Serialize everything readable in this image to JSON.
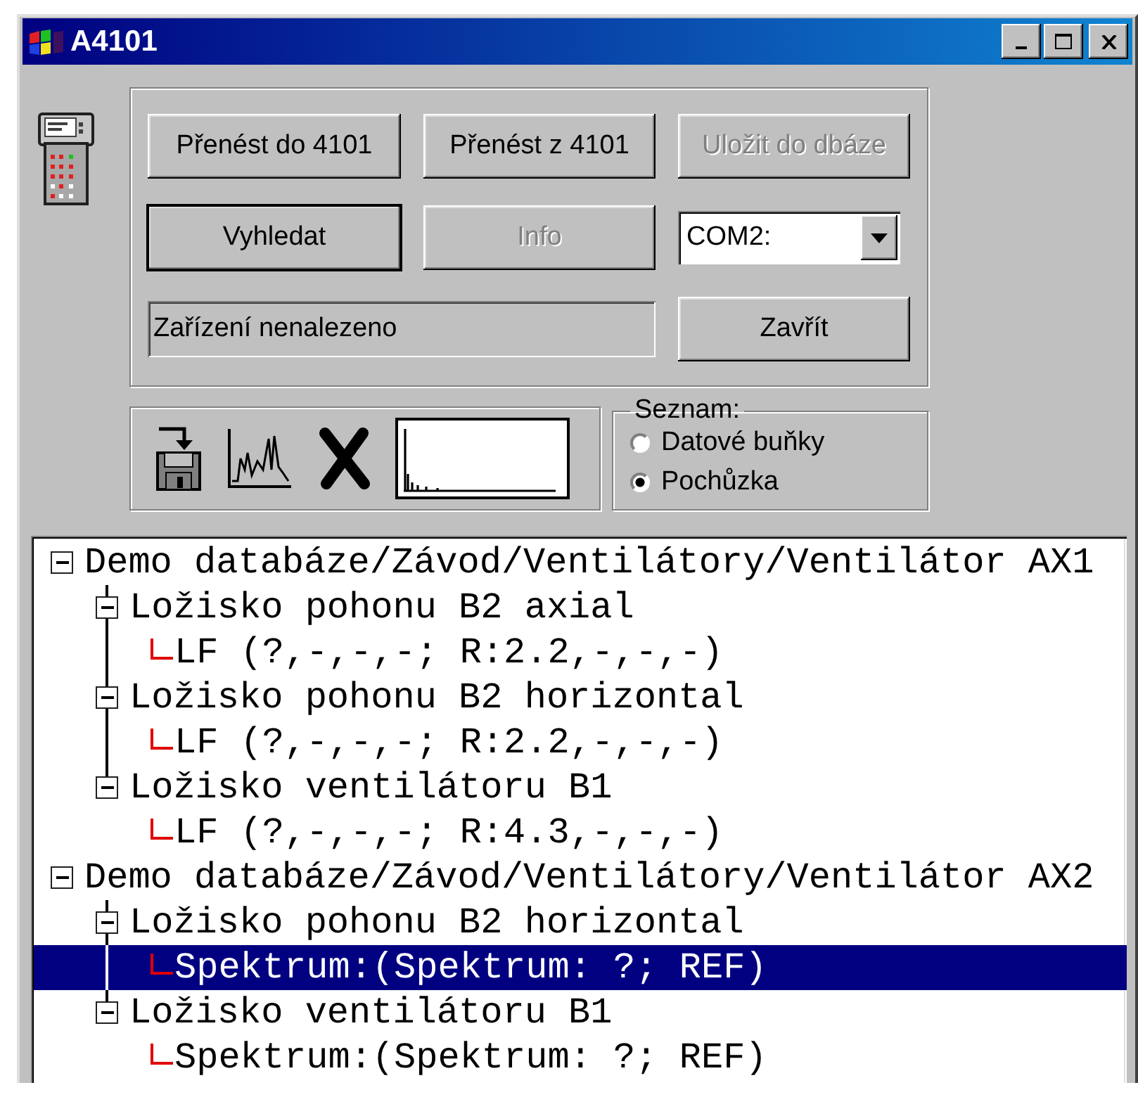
{
  "window": {
    "title": "A4101"
  },
  "actions": {
    "row_1": [
      {
        "label": "Přenést do 4101",
        "disabled": false,
        "default": false
      },
      {
        "label": "Přenést z 4101",
        "disabled": false,
        "default": false
      },
      {
        "label": "Uložit do dbáze",
        "disabled": true,
        "default": false
      }
    ],
    "row_2": [
      {
        "label": "Vyhledat",
        "disabled": false,
        "default": true
      },
      {
        "label": "Info",
        "disabled": true,
        "default": false
      }
    ],
    "port": {
      "value": "COM2:"
    },
    "status": "Zařízení nenalezeno",
    "close_button": "Zavřít"
  },
  "list_type": {
    "title": "Seznam:",
    "options": [
      {
        "label": "Datové buňky",
        "selected": false
      },
      {
        "label": "Pochůzka",
        "selected": true
      }
    ]
  },
  "tree": [
    {
      "label": "Demo databáze/Závod/Ventilátory/Ventilátor AX1",
      "expanded": true,
      "selected": false,
      "children": [
        {
          "label": "Ložisko pohonu B2 axial",
          "expanded": true,
          "selected": false,
          "children": [
            {
              "label": "LF (?,-,-,-; R:2.2,-,-,-)",
              "selected": false
            }
          ]
        },
        {
          "label": "Ložisko pohonu B2 horizontal",
          "expanded": true,
          "selected": false,
          "children": [
            {
              "label": "LF (?,-,-,-; R:2.2,-,-,-)",
              "selected": false
            }
          ]
        },
        {
          "label": "Ložisko ventilátoru B1",
          "expanded": true,
          "selected": false,
          "children": [
            {
              "label": "LF (?,-,-,-; R:4.3,-,-,-)",
              "selected": false
            }
          ]
        }
      ]
    },
    {
      "label": "Demo databáze/Závod/Ventilátory/Ventilátor AX2",
      "expanded": true,
      "selected": false,
      "children": [
        {
          "label": "Ložisko pohonu B2 horizontal",
          "expanded": true,
          "selected": false,
          "children": [
            {
              "label": "Spektrum:(Spektrum: ?; REF)",
              "selected": true
            }
          ]
        },
        {
          "label": "Ložisko ventilátoru B1",
          "expanded": true,
          "selected": false,
          "children": [
            {
              "label": "Spektrum:(Spektrum: ?; REF)",
              "selected": false
            }
          ]
        }
      ]
    }
  ]
}
